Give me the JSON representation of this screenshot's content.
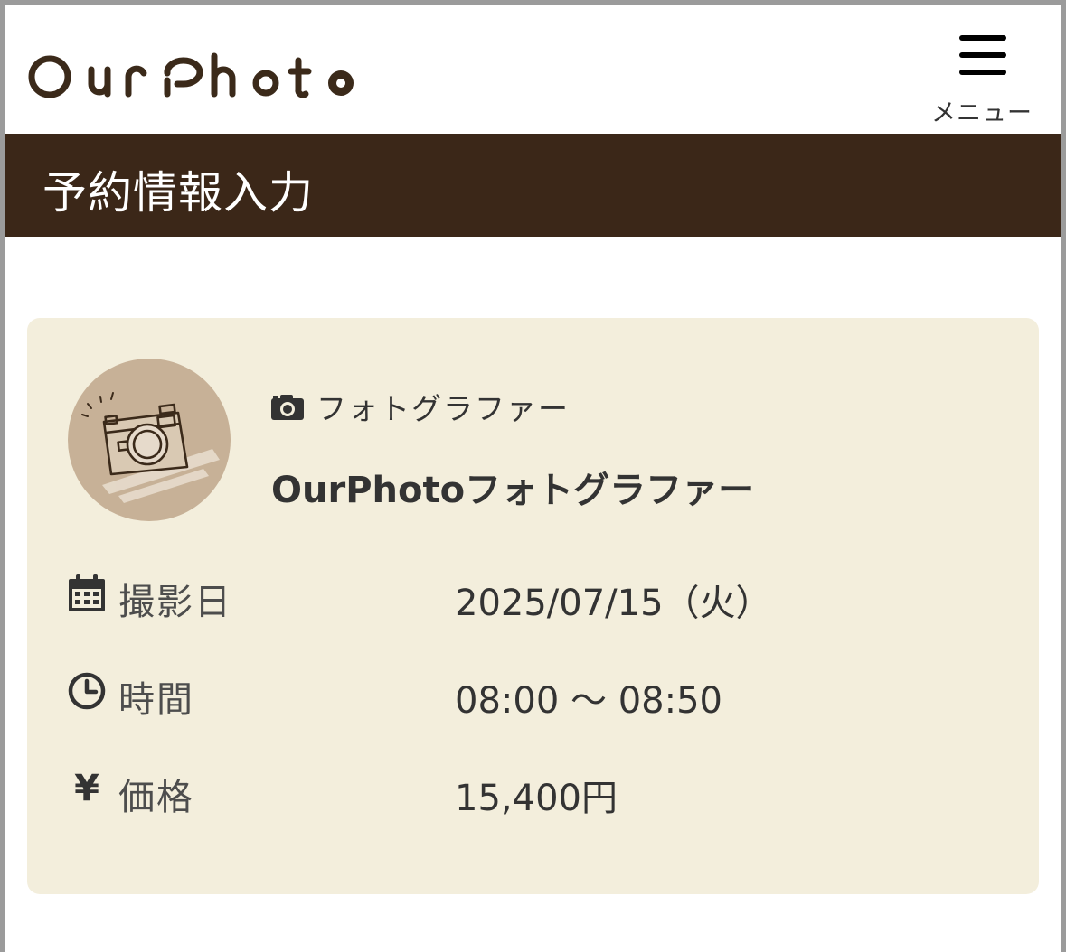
{
  "header": {
    "logo_text": "OurPhoto",
    "menu_label": "メニュー"
  },
  "page": {
    "title": "予約情報入力"
  },
  "booking": {
    "photographer": {
      "role_label": "フォトグラファー",
      "name": "OurPhotoフォトグラファー"
    },
    "details": [
      {
        "icon": "calendar-icon",
        "label": "撮影日",
        "value": "2025/07/15（火）"
      },
      {
        "icon": "clock-icon",
        "label": "時間",
        "value": "08:00 ～ 08:50"
      },
      {
        "icon": "yen-icon",
        "label": "価格",
        "value": "15,400円"
      }
    ],
    "yen_symbol": "¥"
  },
  "colors": {
    "brand_dark": "#3b2718",
    "card_background": "#f3eedc",
    "avatar_background": "#c7b197"
  }
}
